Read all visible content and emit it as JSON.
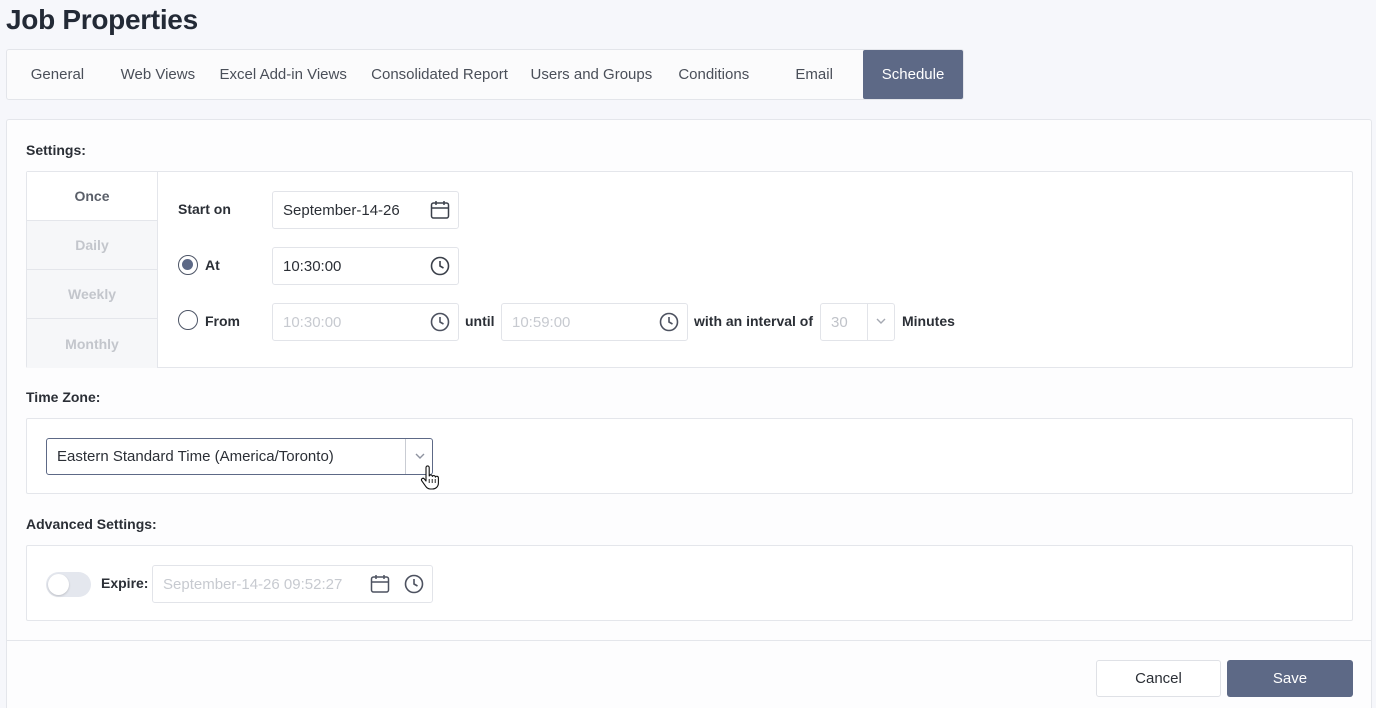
{
  "page_title": "Job Properties",
  "tabs": [
    {
      "label": "General"
    },
    {
      "label": "Web Views"
    },
    {
      "label": "Excel Add-in Views"
    },
    {
      "label": "Consolidated Report"
    },
    {
      "label": "Users and Groups"
    },
    {
      "label": "Conditions"
    },
    {
      "label": "Email"
    },
    {
      "label": "Schedule",
      "active": true
    }
  ],
  "settings": {
    "label": "Settings:",
    "frequencies": [
      "Once",
      "Daily",
      "Weekly",
      "Monthly"
    ],
    "active_frequency": "Once",
    "start_on_label": "Start on",
    "start_on_value": "September-14-26",
    "at_label": "At",
    "at_value": "10:30:00",
    "at_selected": true,
    "from_label": "From",
    "from_value": "10:30:00",
    "until_label": "until",
    "until_value": "10:59:00",
    "interval_label": "with an interval of",
    "interval_value": "30",
    "minutes_label": "Minutes"
  },
  "timezone": {
    "label": "Time Zone:",
    "value": "Eastern Standard Time (America/Toronto)"
  },
  "advanced": {
    "label": "Advanced Settings:",
    "expire_label": "Expire:",
    "expire_enabled": false,
    "expire_value": "September-14-26 09:52:27"
  },
  "footer": {
    "cancel_label": "Cancel",
    "save_label": "Save"
  },
  "colors": {
    "accent": "#5d6986",
    "background": "#f6f7fb"
  }
}
